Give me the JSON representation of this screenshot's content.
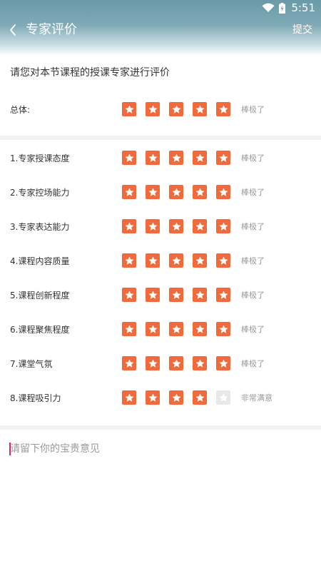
{
  "status_bar": {
    "time": "5:51",
    "icons": [
      "wifi-icon",
      "battery-charging-icon"
    ]
  },
  "header": {
    "back_icon": "chevron-left-icon",
    "title": "专家评价",
    "submit_label": "提交"
  },
  "colors": {
    "accent": "#f26a3c",
    "star_empty": "#e8e8e8",
    "caret": "#e91e63"
  },
  "prompt": "请您对本节课程的授课专家进行评价",
  "overall": {
    "label": "总体:",
    "rating": 5,
    "max": 5,
    "status": "棒极了"
  },
  "criteria": [
    {
      "label": "1.专家授课态度",
      "rating": 5,
      "max": 5,
      "status": "棒极了"
    },
    {
      "label": "2.专家控场能力",
      "rating": 5,
      "max": 5,
      "status": "棒极了"
    },
    {
      "label": "3.专家表达能力",
      "rating": 5,
      "max": 5,
      "status": "棒极了"
    },
    {
      "label": "4.课程内容质量",
      "rating": 5,
      "max": 5,
      "status": "棒极了"
    },
    {
      "label": "5.课程创新程度",
      "rating": 5,
      "max": 5,
      "status": "棒极了"
    },
    {
      "label": "6.课程聚焦程度",
      "rating": 5,
      "max": 5,
      "status": "棒极了"
    },
    {
      "label": "7.课堂气氛",
      "rating": 5,
      "max": 5,
      "status": "棒极了"
    },
    {
      "label": "8.课程吸引力",
      "rating": 4,
      "max": 5,
      "status": "非常满意"
    }
  ],
  "comment": {
    "placeholder": "请留下你的宝贵意见"
  }
}
